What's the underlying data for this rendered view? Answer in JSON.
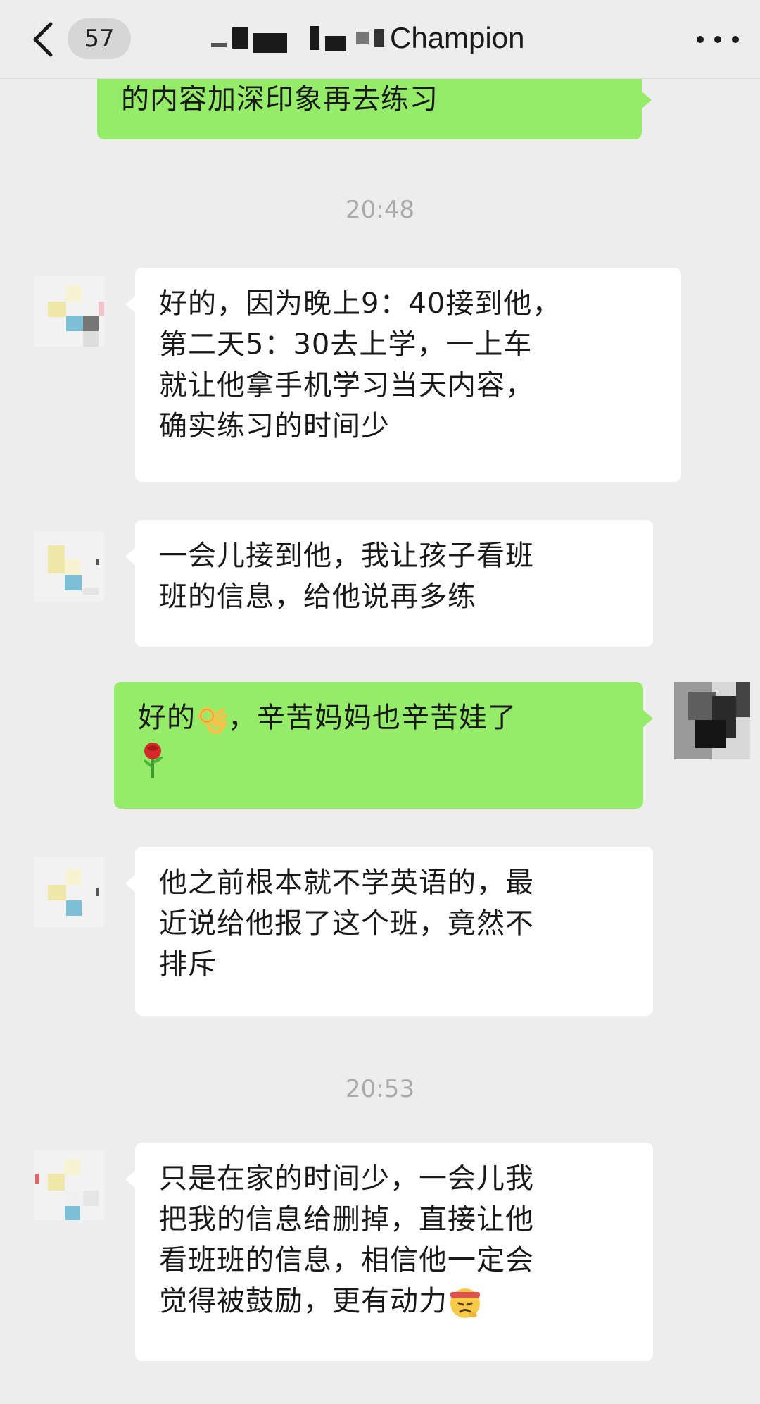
{
  "header": {
    "back_icon": "chevron-left-icon",
    "unread_count": "57",
    "title": "Champion",
    "more_icon": "more-dots-icon"
  },
  "messages": [
    {
      "id": "m0",
      "side": "out",
      "text_lines": [
        "的内容加深印象再去练习"
      ]
    },
    {
      "id": "ts1",
      "type": "timestamp",
      "text": "20:48"
    },
    {
      "id": "m1",
      "side": "in",
      "text_lines": [
        "好的，因为晚上9：40接到他，",
        "第二天5：30去上学，一上车",
        "就让他拿手机学习当天内容，",
        "确实练习的时间少"
      ]
    },
    {
      "id": "m2",
      "side": "in",
      "text_lines": [
        "一会儿接到他，我让孩子看班",
        "班的信息，给他说再多练"
      ]
    },
    {
      "id": "m3",
      "side": "out",
      "text_before": "好的",
      "emoji_1": "ok-hand-emoji",
      "text_after": "，辛苦妈妈也辛苦娃了",
      "emoji_2": "rose-emoji"
    },
    {
      "id": "m4",
      "side": "in",
      "text_lines": [
        "他之前根本就不学英语的，最",
        "近说给他报了这个班，竟然不",
        "排斥"
      ]
    },
    {
      "id": "ts2",
      "type": "timestamp",
      "text": "20:53"
    },
    {
      "id": "m5",
      "side": "in",
      "text_lines": [
        "只是在家的时间少，一会儿我",
        "把我的信息给删掉，直接让他",
        "看班班的信息，相信他一定会",
        "觉得被鼓励，更有动力"
      ],
      "emoji": "determined-face-emoji"
    }
  ],
  "colors": {
    "background": "#ededed",
    "incoming_bubble": "#ffffff",
    "outgoing_bubble": "#95ec69",
    "timestamp_text": "#aaaaaa"
  }
}
